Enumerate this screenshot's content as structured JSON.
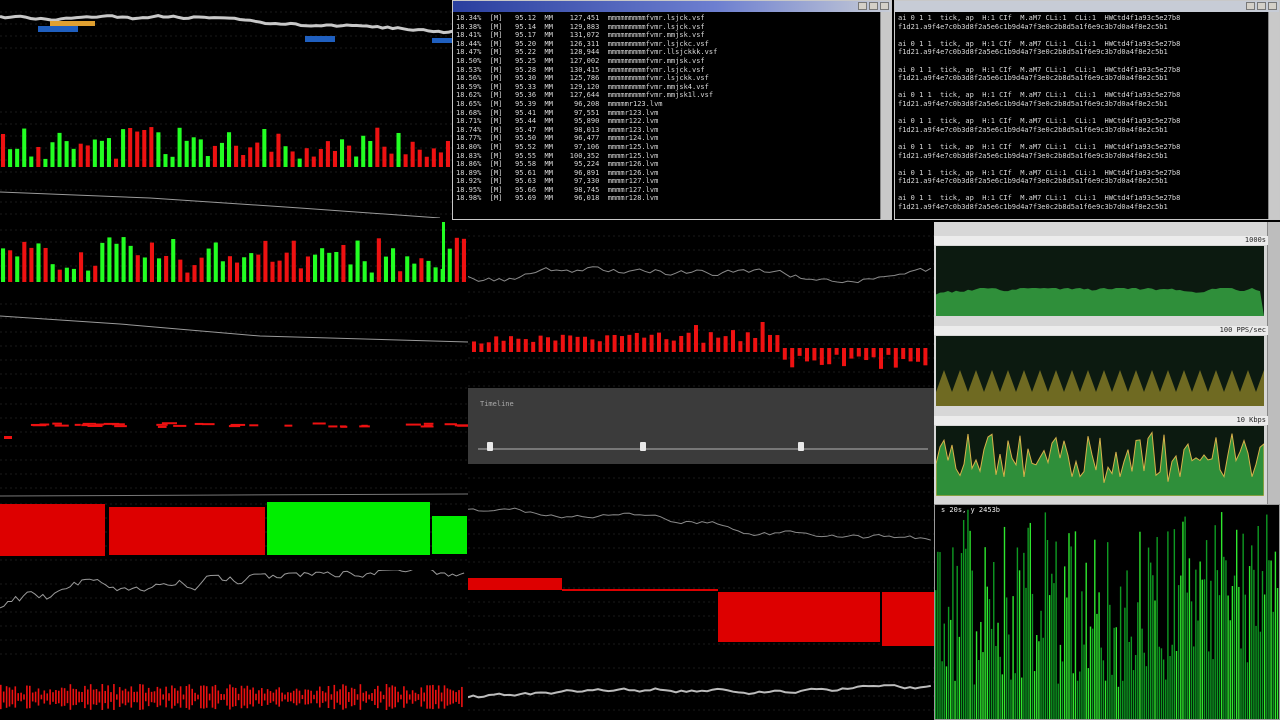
{
  "colors": {
    "background": "#000000",
    "bar_green": "#22ff22",
    "bar_red": "#ee1111",
    "block_red": "#dd0000",
    "block_green": "#00ee00",
    "grid": "#1a1a1a",
    "line_gray": "#9a9a9a",
    "monitor_green": "#2f8f3a",
    "monitor_olive": "#6f6a22"
  },
  "icons": {
    "titlebar_buttons": [
      "minimize-icon",
      "maximize-icon",
      "close-icon"
    ]
  },
  "term_left": {
    "lines": [
      "18.34%  [M]   95.12  MM    127,451  mmmmmmmmmfvmr.lsjck.vsf",
      "18.38%  [M]   95.14  MM    129,883  mmmmmmmmmfvmr.lsjck.vsf",
      "18.41%  [M]   95.17  MM    131,072  mmmmmmmmmfvmr.mmjsk.vsf",
      "18.44%  [M]   95.20  MM    126,311  mmmmmmmmmfvmr.lsjckc.vsf",
      "18.47%  [M]   95.22  MM    128,944  mmmmmmmmmfvmr.llsjckkk.vsf",
      "18.50%  [M]   95.25  MM    127,002  mmmmmmmmmfvmr.mmjsk.vsf",
      "18.53%  [M]   95.28  MM    130,415  mmmmmmmmmfvmr.lsjck.vsf",
      "18.56%  [M]   95.30  MM    125,786  mmmmmmmmmfvmr.lsjckk.vsf",
      "18.59%  [M]   95.33  MM    129,120  mmmmmmmmmfvmr.mmjsk4.vsf",
      "18.62%  [M]   95.36  MM    127,644  mmmmmmmmmfvmr.mmjsk1l.vsf",
      "18.65%  [M]   95.39  MM     96,208  mmmmmr123.lvm",
      "18.68%  [M]   95.41  MM     97,551  mmmmr123.lvm",
      "18.71%  [M]   95.44  MM     95,890  mmmmr122.lvm",
      "18.74%  [M]   95.47  MM     98,013  mmmmr123.lvm",
      "18.77%  [M]   95.50  MM     96,477  mmmmr124.lvm",
      "18.80%  [M]   95.52  MM     97,106  mmmmr125.lvm",
      "18.83%  [M]   95.55  MM    100,352  mmmmr125.lvm",
      "18.86%  [M]   95.58  MM     95,224  mmmmr126.lvm",
      "18.89%  [M]   95.61  MM     96,891  mmmmr126.lvm",
      "18.92%  [M]   95.63  MM     97,330  mmmmr127.lvm",
      "18.95%  [M]   95.66  MM     98,745  mmmmr127.lvm",
      "18.98%  [M]   95.69  MM     96,018  mmmmr128.lvm"
    ]
  },
  "term_right": {
    "lines": [
      "ai 0 1 1  tick, ap  H:1 CIf  M.aM7 CLi:1  CLi:1  HWCtd4f1a93c5e27b8",
      "f1d21.a9f4e7c0b3d8f2a5e6c1b9d4a7f3e0c2b8d5a1f6e9c3b7d0a4f8e2c5b1",
      "",
      "ai 0 1 1  tick, ap  H:1 CIf  M.aM7 CLi:1  CLi:1  HWCtd4f1a93c5e27b8",
      "f1d21.a9f4e7c0b3d8f2a5e6c1b9d4a7f3e0c2b8d5a1f6e9c3b7d0a4f8e2c5b1",
      "",
      "ai 0 1 1  tick, ap  H:1 CIf  M.aM7 CLi:1  CLi:1  HWCtd4f1a93c5e27b8",
      "f1d21.a9f4e7c0b3d8f2a5e6c1b9d4a7f3e0c2b8d5a1f6e9c3b7d0a4f8e2c5b1",
      "",
      "ai 0 1 1  tick, ap  H:1 CIf  M.aM7 CLi:1  CLi:1  HWCtd4f1a93c5e27b8",
      "f1d21.a9f4e7c0b3d8f2a5e6c1b9d4a7f3e0c2b8d5a1f6e9c3b7d0a4f8e2c5b1",
      "",
      "ai 0 1 1  tick, ap  H:1 CIf  M.aM7 CLi:1  CLi:1  HWCtd4f1a93c5e27b8",
      "f1d21.a9f4e7c0b3d8f2a5e6c1b9d4a7f3e0c2b8d5a1f6e9c3b7d0a4f8e2c5b1",
      "",
      "ai 0 1 1  tick, ap  H:1 CIf  M.aM7 CLi:1  CLi:1  HWCtd4f1a93c5e27b8",
      "f1d21.a9f4e7c0b3d8f2a5e6c1b9d4a7f3e0c2b8d5a1f6e9c3b7d0a4f8e2c5b1",
      "",
      "ai 0 1 1  tick, ap  H:1 CIf  M.aM7 CLi:1  CLi:1  HWCtd4f1a93c5e27b8",
      "f1d21.a9f4e7c0b3d8f2a5e6c1b9d4a7f3e0c2b8d5a1f6e9c3b7d0a4f8e2c5b1",
      "",
      "ai 0 1 1  tick, ap  H:1 CIf  M.aM7 CLi:1  CLi:1  HWCtd4f1a93c5e27b8",
      "f1d21.a9f4e7c0b3d8f2a5e6c1b9d4a7f3e0c2b8d5a1f6e9c3b7d0a4f8e2c5b1"
    ]
  },
  "monitor": {
    "graphs": [
      {
        "label": "1000s"
      },
      {
        "label": "100 PPS/sec"
      },
      {
        "label": "10 Kbps"
      }
    ]
  },
  "big_graph": {
    "label": "s 20s, y 2453b"
  },
  "slider": {
    "title": "Timeline",
    "knob_levels": [
      0.02,
      0.36,
      0.71
    ]
  }
}
